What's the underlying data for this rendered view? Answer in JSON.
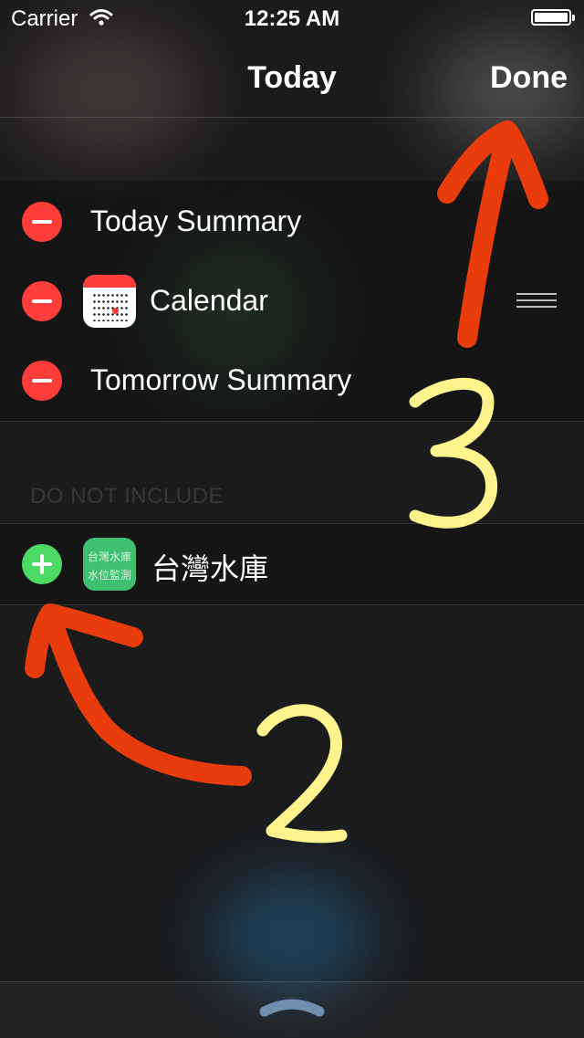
{
  "status_bar": {
    "carrier": "Carrier",
    "time": "12:25 AM"
  },
  "nav": {
    "title": "Today",
    "done_label": "Done"
  },
  "included_widgets": [
    {
      "label": "Today Summary"
    },
    {
      "label": "Calendar"
    },
    {
      "label": "Tomorrow Summary"
    }
  ],
  "excluded_section": {
    "header": "DO NOT INCLUDE",
    "items": [
      {
        "label": "台灣水庫",
        "icon_text_line1": "台灣水庫",
        "icon_text_line2": "水位監測"
      }
    ]
  },
  "annotations": {
    "step_add": "2",
    "step_done": "3"
  },
  "colors": {
    "minus": "#fc3d39",
    "plus": "#4cd964",
    "arrow": "#e83c0c",
    "handwriting": "#fef38c"
  }
}
